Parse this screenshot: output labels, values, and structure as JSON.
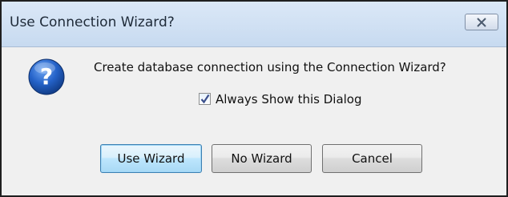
{
  "dialog": {
    "title": "Use Connection Wizard?",
    "close_icon": "close-icon",
    "question_icon": "question-icon",
    "message": "Create database connection using the Connection Wizard?",
    "checkbox": {
      "label": "Always Show this Dialog",
      "checked": true
    },
    "buttons": {
      "use_wizard": "Use Wizard",
      "no_wizard": "No Wizard",
      "cancel": "Cancel"
    }
  },
  "colors": {
    "title_bar": "#c7daf0",
    "icon_blue": "#1d56b8",
    "default_button_border": "#3c7fb1"
  }
}
